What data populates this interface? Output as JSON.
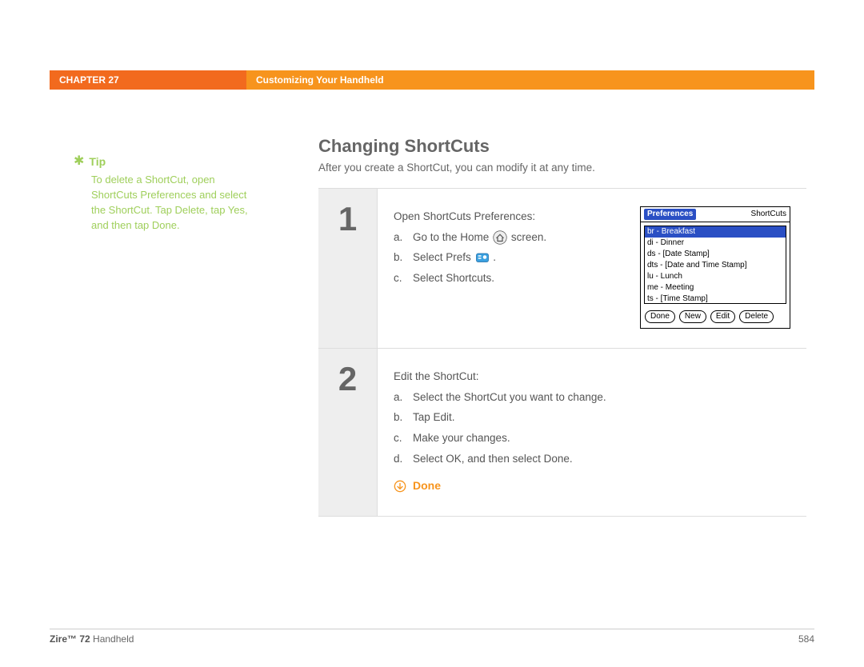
{
  "header": {
    "chapter": "CHAPTER 27",
    "title": "Customizing Your Handheld"
  },
  "tip": {
    "label": "Tip",
    "body": "To delete a ShortCut, open ShortCuts Preferences and select the ShortCut. Tap Delete, tap Yes, and then tap Done."
  },
  "main": {
    "heading": "Changing ShortCuts",
    "intro": "After you create a ShortCut, you can modify it at any time."
  },
  "steps": [
    {
      "num": "1",
      "title": "Open ShortCuts Preferences:",
      "items": [
        {
          "lbl": "a.",
          "pre": "Go to the Home ",
          "post": " screen."
        },
        {
          "lbl": "b.",
          "pre": "Select Prefs ",
          "post": " ."
        },
        {
          "lbl": "c.",
          "text": "Select Shortcuts."
        }
      ]
    },
    {
      "num": "2",
      "title": "Edit the ShortCut:",
      "items": [
        {
          "lbl": "a.",
          "text": "Select the ShortCut you want to change."
        },
        {
          "lbl": "b.",
          "text": "Tap Edit."
        },
        {
          "lbl": "c.",
          "text": "Make your changes."
        },
        {
          "lbl": "d.",
          "text": "Select OK, and then select Done."
        }
      ],
      "done": "Done"
    }
  ],
  "palm": {
    "title_left": "Preferences",
    "title_right": "ShortCuts",
    "items": [
      {
        "text": "br - Breakfast",
        "selected": true
      },
      {
        "text": "di - Dinner"
      },
      {
        "text": "ds - [Date Stamp]"
      },
      {
        "text": "dts - [Date and Time Stamp]"
      },
      {
        "text": "lu - Lunch"
      },
      {
        "text": "me - Meeting"
      },
      {
        "text": "ts - [Time Stamp]"
      }
    ],
    "buttons": [
      "Done",
      "New",
      "Edit",
      "Delete"
    ]
  },
  "footer": {
    "product_bold": "Zire™ 72",
    "product_rest": " Handheld",
    "page": "584"
  }
}
